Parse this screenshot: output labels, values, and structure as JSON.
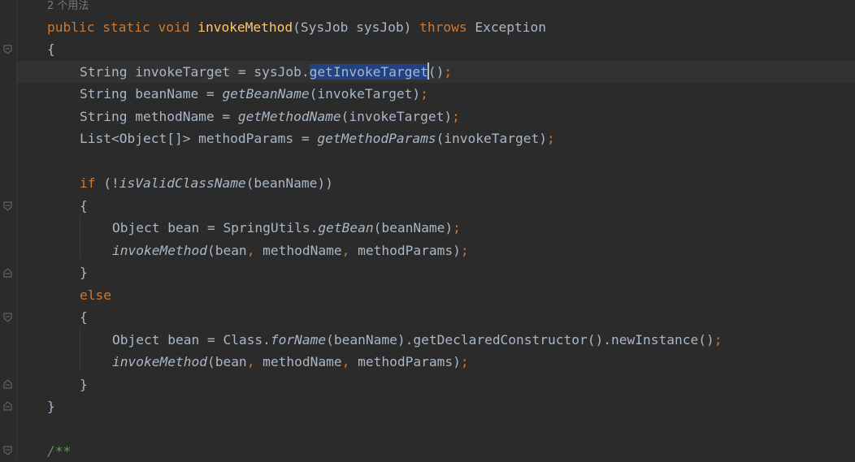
{
  "editor": {
    "usage_hint": "2 个用法",
    "lines": {
      "l1": {
        "m": "public",
        "s": "static",
        "v": "void",
        "name": "invokeMethod",
        "p1": "(SysJob sysJob) ",
        "thr": "throws",
        "exc": " Exception"
      },
      "l2": {
        "t": "{"
      },
      "l3": {
        "a": "String invokeTarget = sysJob.",
        "sel": "getInvokeTarget",
        "b": "()",
        "semi": ";"
      },
      "l4": {
        "a": "String beanName = ",
        "fn": "getBeanName",
        "b": "(invokeTarget)",
        "semi": ";"
      },
      "l5": {
        "a": "String methodName = ",
        "fn": "getMethodName",
        "b": "(invokeTarget)",
        "semi": ";"
      },
      "l6": {
        "a": "List<Object[]> methodParams = ",
        "fn": "getMethodParams",
        "b": "(invokeTarget)",
        "semi": ";"
      },
      "l8": {
        "kw": "if",
        "a": " (!",
        "fn": "isValidClassName",
        "b": "(beanName))"
      },
      "l9": {
        "t": "{"
      },
      "l10": {
        "a": "Object bean = SpringUtils.",
        "fn": "getBean",
        "b": "(beanName)",
        "semi": ";"
      },
      "l11": {
        "fn": "invokeMethod",
        "a": "(bean",
        "c1": ",",
        "b": " methodName",
        "c2": ",",
        "d": " methodParams)",
        "semi": ";"
      },
      "l12": {
        "t": "}"
      },
      "l13": {
        "kw": "else"
      },
      "l14": {
        "t": "{"
      },
      "l15": {
        "a": "Object bean = Class.",
        "fn": "forName",
        "b": "(beanName).getDeclaredConstructor().newInstance()",
        "semi": ";"
      },
      "l16": {
        "fn": "invokeMethod",
        "a": "(bean",
        "c1": ",",
        "b": " methodName",
        "c2": ",",
        "d": " methodParams)",
        "semi": ";"
      },
      "l17": {
        "t": "}"
      },
      "l18": {
        "t": "}"
      },
      "l20": {
        "doc": "/**"
      }
    }
  },
  "colors": {
    "background": "#2b2b2b",
    "keyword": "#cc7832",
    "method_declaration": "#ffc66d",
    "text": "#a9b7c6",
    "selection": "#214283",
    "doc_comment": "#629755",
    "usage_hint": "#787878"
  },
  "icons": [
    "fold-open-icon",
    "fold-close-icon"
  ]
}
